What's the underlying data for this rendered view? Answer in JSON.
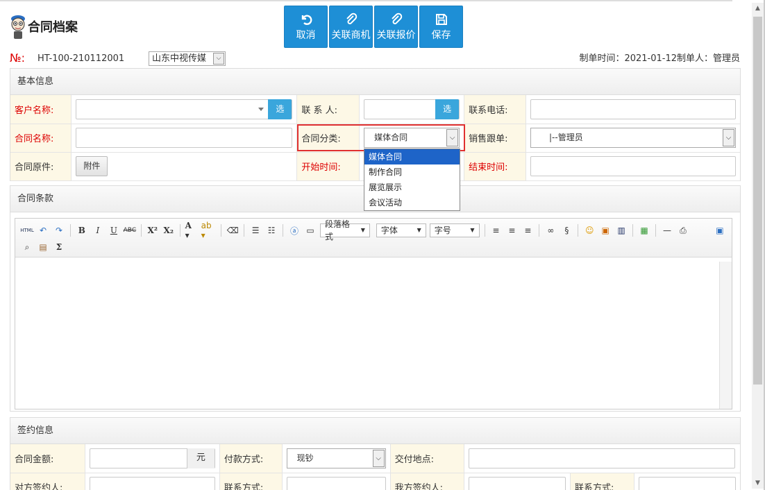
{
  "header": {
    "title": "合同档案",
    "no_label": "№:",
    "no_value": "HT-100-210112001",
    "company": "山东中视传媒",
    "meta": "制单时间：2021-01-12制单人：管理员"
  },
  "toolbar": {
    "cancel": "取消",
    "link_opportunity": "关联商机",
    "link_quote": "关联报价",
    "save": "保存"
  },
  "basic": {
    "heading": "基本信息",
    "customer_label": "客户名称:",
    "pick": "选",
    "contact_label": "联 系 人:",
    "phone_label": "联系电话:",
    "contract_name_label": "合同名称:",
    "category_label": "合同分类:",
    "category_value": "媒体合同",
    "sales_label": "销售跟单:",
    "sales_value": "|--管理员",
    "original_label": "合同原件:",
    "attach_button": "附件",
    "start_label": "开始时间:",
    "end_label": "结束时间:"
  },
  "category_options": [
    "媒体合同",
    "制作合同",
    "展览展示",
    "会议活动"
  ],
  "terms": {
    "heading": "合同条款",
    "paragraph_format": "段落格式",
    "font": "字体",
    "font_size": "字号",
    "html_label": "HTML"
  },
  "sign": {
    "heading": "签约信息",
    "amount_label": "合同金额:",
    "currency": "元",
    "pay_label": "付款方式:",
    "pay_value": "现钞",
    "delivery_label": "交付地点:",
    "counter_signer_label": "对方签约人:",
    "contact_method_label": "联系方式:",
    "our_signer_label": "我方签约人:",
    "contact_method2_label": "联系方式:"
  },
  "colors": {
    "primary": "#1e8fd6",
    "required": "#dd0000",
    "highlight": "#e03030",
    "selected": "#1e64c8"
  }
}
